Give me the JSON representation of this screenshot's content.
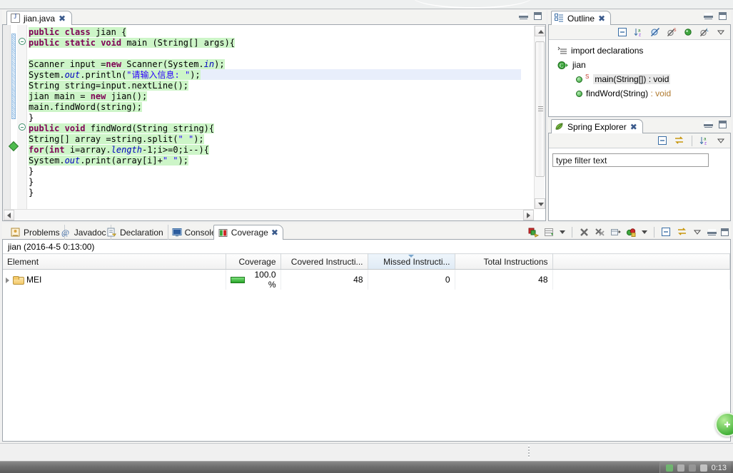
{
  "editor": {
    "tab": {
      "label": "jian.java",
      "icon": "java-file-icon",
      "close": "✖"
    },
    "window_controls": {
      "minimize": "minimize-icon",
      "maximize": "maximize-icon"
    },
    "code_lines": [
      {
        "indent": 0,
        "highlight": true,
        "tokens": [
          {
            "t": "public",
            "c": "kw"
          },
          {
            "t": " ",
            "c": "pl"
          },
          {
            "t": "class",
            "c": "kw"
          },
          {
            "t": " jian {",
            "c": "pl"
          }
        ]
      },
      {
        "indent": 0,
        "highlight": true,
        "fold": true,
        "tokens": [
          {
            "t": "public",
            "c": "kw"
          },
          {
            "t": " ",
            "c": "pl"
          },
          {
            "t": "static",
            "c": "kw"
          },
          {
            "t": " ",
            "c": "pl"
          },
          {
            "t": "void",
            "c": "kw"
          },
          {
            "t": " main (String[] args){",
            "c": "pl"
          }
        ]
      },
      {
        "indent": 0,
        "highlight": false,
        "tokens": []
      },
      {
        "indent": 0,
        "highlight": true,
        "tokens": [
          {
            "t": "Scanner input =",
            "c": "pl"
          },
          {
            "t": "new",
            "c": "kw"
          },
          {
            "t": " Scanner(System.",
            "c": "pl"
          },
          {
            "t": "in",
            "c": "fld"
          },
          {
            "t": ");",
            "c": "pl"
          }
        ]
      },
      {
        "indent": 0,
        "highlight": true,
        "current": true,
        "tokens": [
          {
            "t": "System.",
            "c": "pl"
          },
          {
            "t": "out",
            "c": "fld"
          },
          {
            "t": ".println(",
            "c": "pl"
          },
          {
            "t": "\"请输入信息: \"",
            "c": "str"
          },
          {
            "t": ");",
            "c": "pl"
          }
        ]
      },
      {
        "indent": 0,
        "highlight": true,
        "tokens": [
          {
            "t": "String string=input.nextLine();",
            "c": "pl"
          }
        ]
      },
      {
        "indent": 0,
        "highlight": true,
        "tokens": [
          {
            "t": "jian main = ",
            "c": "pl"
          },
          {
            "t": "new",
            "c": "kw"
          },
          {
            "t": " jian();",
            "c": "pl"
          }
        ]
      },
      {
        "indent": 0,
        "highlight": true,
        "tokens": [
          {
            "t": "main.findWord(string);",
            "c": "pl"
          }
        ]
      },
      {
        "indent": 0,
        "highlight": false,
        "tokens": [
          {
            "t": "}",
            "c": "pl"
          }
        ]
      },
      {
        "indent": 0,
        "highlight": true,
        "fold": true,
        "tokens": [
          {
            "t": "public",
            "c": "kw"
          },
          {
            "t": " ",
            "c": "pl"
          },
          {
            "t": "void",
            "c": "kw"
          },
          {
            "t": " findWord(String string){",
            "c": "pl"
          }
        ]
      },
      {
        "indent": 0,
        "highlight": true,
        "tokens": [
          {
            "t": "String[] array =string.split(",
            "c": "pl"
          },
          {
            "t": "\" \"",
            "c": "str"
          },
          {
            "t": ");",
            "c": "pl"
          }
        ]
      },
      {
        "indent": 0,
        "highlight": true,
        "bookmark": true,
        "tokens": [
          {
            "t": "for",
            "c": "kw"
          },
          {
            "t": "(",
            "c": "pl"
          },
          {
            "t": "int",
            "c": "kw"
          },
          {
            "t": " i=array.",
            "c": "pl"
          },
          {
            "t": "length",
            "c": "fld"
          },
          {
            "t": "-1;i>=0;i--){",
            "c": "pl"
          }
        ]
      },
      {
        "indent": 0,
        "highlight": true,
        "tokens": [
          {
            "t": "System.",
            "c": "pl"
          },
          {
            "t": "out",
            "c": "fld"
          },
          {
            "t": ".print(array[i]+",
            "c": "pl"
          },
          {
            "t": "\" \"",
            "c": "str"
          },
          {
            "t": ");",
            "c": "pl"
          }
        ]
      },
      {
        "indent": 0,
        "highlight": false,
        "tokens": [
          {
            "t": "}",
            "c": "pl"
          }
        ]
      },
      {
        "indent": 0,
        "highlight": false,
        "tokens": [
          {
            "t": "}",
            "c": "pl"
          }
        ]
      },
      {
        "indent": 0,
        "highlight": false,
        "tokens": [
          {
            "t": "}",
            "c": "pl"
          }
        ]
      }
    ]
  },
  "outline": {
    "tab": {
      "label": "Outline",
      "icon": "outline-icon",
      "close": "✖"
    },
    "toolbar": [
      {
        "name": "collapse-all-icon",
        "glyph": "⊟"
      },
      {
        "name": "sort-alphabetically-icon",
        "glyph": "↓ᵃz"
      },
      {
        "name": "hide-fields-icon",
        "glyph": "⊘"
      },
      {
        "name": "hide-static-fields-icon",
        "glyph": "⊘ˢ"
      },
      {
        "name": "hide-non-public-icon",
        "glyph": "●"
      },
      {
        "name": "hide-local-types-icon",
        "glyph": "⊘ᴸ"
      },
      {
        "name": "view-menu-icon",
        "glyph": "▽"
      }
    ],
    "items": [
      {
        "label": "import declarations",
        "icon": "import-declarations-icon",
        "indent": false,
        "selected": false
      },
      {
        "label": "jian",
        "icon": "class-icon",
        "indent": false,
        "selected": false
      },
      {
        "label": "main(String[]) : void",
        "icon": "method-public-static-icon",
        "indent": true,
        "selected": true,
        "static": "S"
      },
      {
        "label": "findWord(String)",
        "suffix": " : void",
        "icon": "method-public-icon",
        "indent": true,
        "selected": false
      }
    ]
  },
  "spring_explorer": {
    "tab": {
      "label": "Spring Explorer",
      "icon": "spring-leaf-icon",
      "close": "✖"
    },
    "toolbar": [
      {
        "name": "collapse-all-icon",
        "glyph": "⊟"
      },
      {
        "name": "link-with-editor-icon",
        "glyph": "⇄"
      },
      {
        "name": "sort-alphabetically-icon",
        "glyph": "↓ᵃz"
      },
      {
        "name": "view-menu-icon",
        "glyph": "▽"
      }
    ],
    "filter_placeholder": "type filter text",
    "filter_value": "type filter text"
  },
  "bottom": {
    "tabs": [
      {
        "label": "Problems",
        "icon": "problems-icon",
        "active": false,
        "closable": false
      },
      {
        "label": "Javadoc",
        "icon": "javadoc-icon",
        "active": false,
        "closable": false
      },
      {
        "label": "Declaration",
        "icon": "declaration-icon",
        "active": false,
        "closable": false
      },
      {
        "label": "Console",
        "icon": "console-icon",
        "active": false,
        "closable": false
      },
      {
        "label": "Coverage",
        "icon": "coverage-icon",
        "active": true,
        "closable": true,
        "close": "✖"
      }
    ],
    "toolbar": [
      {
        "name": "coverage-run-icon",
        "glyph": "◧"
      },
      {
        "name": "select-columns-icon",
        "glyph": "▤"
      },
      {
        "name": "columns-dropdown-icon",
        "glyph": "▾"
      },
      {
        "name": "remove-session-icon",
        "glyph": "✖"
      },
      {
        "name": "remove-all-sessions-icon",
        "glyph": "✖✖"
      },
      {
        "name": "import-session-icon",
        "glyph": "▤"
      },
      {
        "name": "export-session-icon",
        "glyph": "◉"
      },
      {
        "name": "export-dropdown-icon",
        "glyph": "▾"
      },
      {
        "name": "collapse-all-icon",
        "glyph": "⊟"
      },
      {
        "name": "link-with-selection-icon",
        "glyph": "⇄"
      },
      {
        "name": "view-menu-icon",
        "glyph": "▽"
      },
      {
        "name": "minimize-icon",
        "glyph": "—"
      },
      {
        "name": "maximize-icon",
        "glyph": "▫"
      }
    ],
    "session_label": "jian (2016-4-5 0:13:00)",
    "table": {
      "columns": [
        {
          "label": "Element",
          "align": "left",
          "sorted": false
        },
        {
          "label": "Coverage",
          "align": "right",
          "sorted": false
        },
        {
          "label": "Covered Instructi...",
          "align": "right",
          "sorted": false
        },
        {
          "label": "Missed Instructi...",
          "align": "right",
          "sorted": true
        },
        {
          "label": "Total Instructions",
          "align": "right",
          "sorted": false
        }
      ],
      "rows": [
        {
          "element": "MEI",
          "icon": "project-folder-icon",
          "expandable": true,
          "coverage": "100.0 %",
          "coverage_ratio": 1.0,
          "covered_instructions": "48",
          "missed_instructions": "0",
          "total_instructions": "48"
        }
      ]
    }
  },
  "taskbar": {
    "clock": "0:13",
    "tray_icons": [
      "tray-shield-icon",
      "tray-network-icon",
      "tray-volume-icon",
      "tray-flag-icon"
    ]
  },
  "floating_widget": {
    "name": "floating-green-badge",
    "glyph": "✚"
  }
}
